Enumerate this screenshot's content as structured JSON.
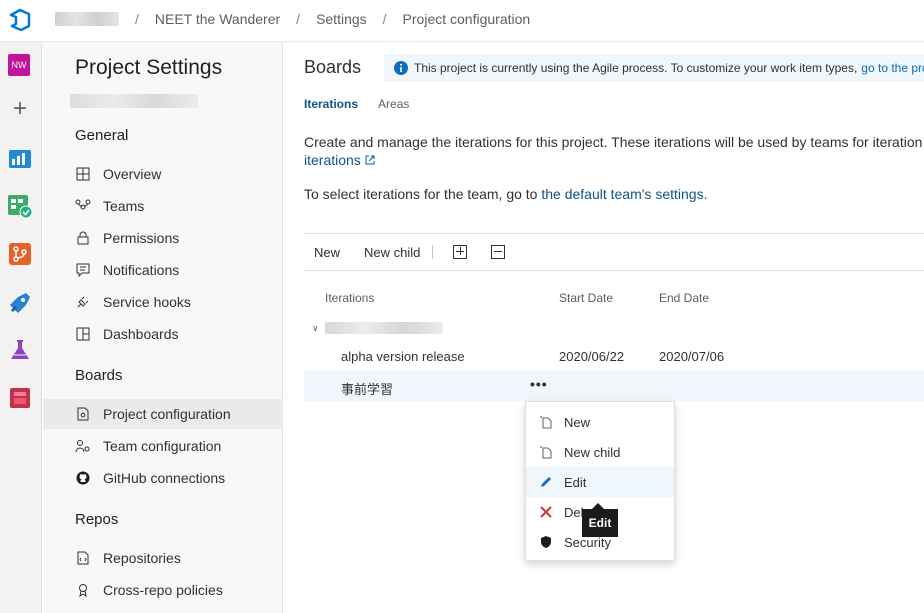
{
  "breadcrumb": {
    "project": "NEET the Wanderer",
    "section": "Settings",
    "page": "Project configuration"
  },
  "rail": {
    "avatar_initials": "NW",
    "avatar_color": "#c1139b"
  },
  "settings": {
    "title": "Project Settings",
    "general_heading": "General",
    "general_items": [
      "Overview",
      "Teams",
      "Permissions",
      "Notifications",
      "Service hooks",
      "Dashboards"
    ],
    "boards_heading": "Boards",
    "boards_items": [
      "Project configuration",
      "Team configuration",
      "GitHub connections"
    ],
    "repos_heading": "Repos",
    "repos_items": [
      "Repositories",
      "Cross-repo policies"
    ]
  },
  "main": {
    "title": "Boards",
    "banner_text": "This project is currently using the Agile process. To customize your work item types,",
    "banner_link": "go to the pro",
    "tabs": [
      "Iterations",
      "Areas"
    ],
    "description": "Create and manage the iterations for this project. These iterations will be used by teams for iteration",
    "description_link": "iterations",
    "team_text": "To select iterations for the team, go to",
    "team_link": "the default team's settings."
  },
  "toolbar": {
    "new_label": "New",
    "new_child_label": "New child"
  },
  "table": {
    "headers": [
      "Iterations",
      "Start Date",
      "End Date"
    ],
    "rows": [
      {
        "name": "alpha version release",
        "start": "2020/06/22",
        "end": "2020/07/06"
      },
      {
        "name": "事前学習",
        "start": "",
        "end": "",
        "more": "•••"
      }
    ]
  },
  "context_menu": {
    "items": [
      "New",
      "New child",
      "Edit",
      "Delete",
      "Security"
    ],
    "hovered": "Edit"
  },
  "tooltip": "Edit",
  "colors": {
    "accent": "#0f6cbd",
    "link": "#0f548c",
    "delete": "#d13438"
  }
}
